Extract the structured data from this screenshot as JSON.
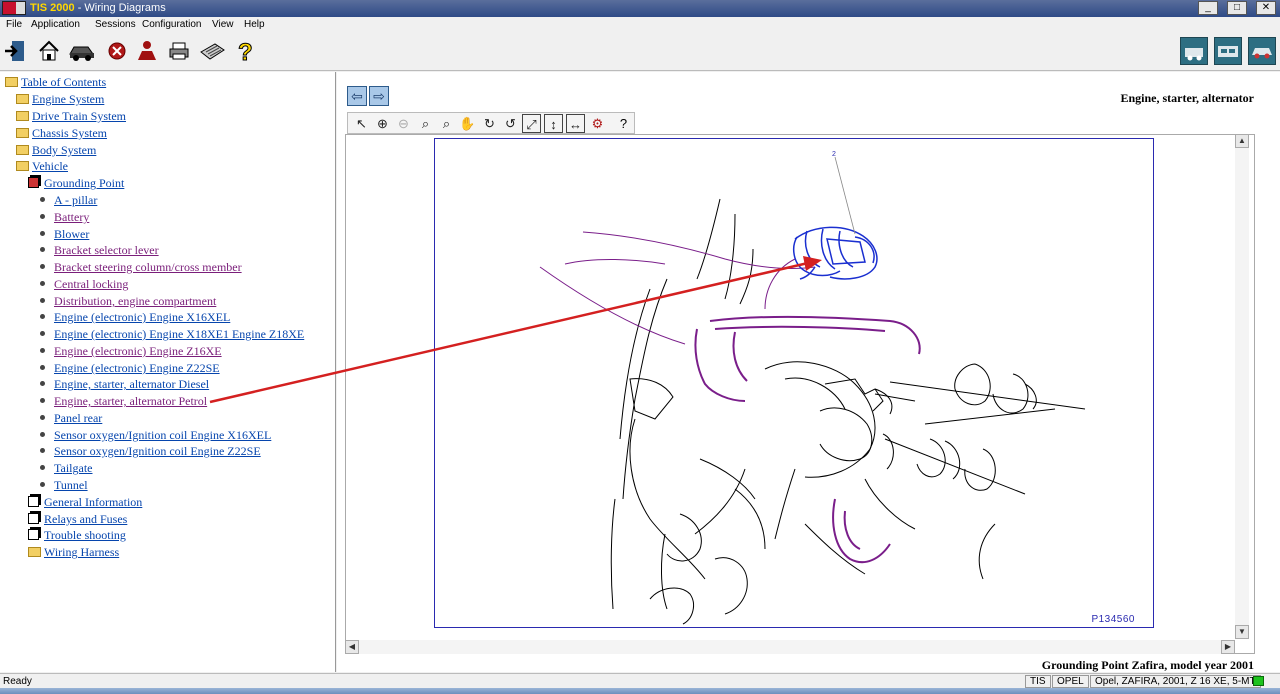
{
  "window": {
    "app_name": "TIS 2000",
    "title": " - Wiring Diagrams",
    "controls": [
      "_",
      "□",
      "✕"
    ]
  },
  "menu": [
    "File",
    "Application",
    "Sessions",
    "Configuration",
    "View",
    "Help"
  ],
  "toolbar_icons": [
    "exit-icon",
    "home-icon",
    "vehicle-icon",
    "stop-icon",
    "person-icon",
    "print-icon",
    "keyboard-icon",
    "help-icon"
  ],
  "toolbar_right_icons": [
    "vehicle-diagnostic-icon",
    "car-module-icon",
    "car-settings-icon"
  ],
  "tree": {
    "root": "Table of Contents",
    "items": [
      {
        "label": "Engine System"
      },
      {
        "label": "Drive Train System"
      },
      {
        "label": "Chassis System"
      },
      {
        "label": "Body System"
      },
      {
        "label": "Vehicle"
      },
      {
        "label": "Grounding Point"
      },
      {
        "label": "A - pillar"
      },
      {
        "label": "Battery"
      },
      {
        "label": "Blower"
      },
      {
        "label": "Bracket selector lever"
      },
      {
        "label": "Bracket steering column/cross member"
      },
      {
        "label": "Central locking"
      },
      {
        "label": "Distribution, engine compartment"
      },
      {
        "label": "Engine (electronic) Engine X16XEL"
      },
      {
        "label": "Engine (electronic) Engine X18XE1 Engine Z18XE"
      },
      {
        "label": "Engine (electronic) Engine Z16XE"
      },
      {
        "label": "Engine (electronic) Engine Z22SE"
      },
      {
        "label": "Engine, starter, alternator Diesel"
      },
      {
        "label": "Engine, starter, alternator Petrol"
      },
      {
        "label": "Panel rear"
      },
      {
        "label": "Sensor oxygen/Ignition coil Engine X16XEL"
      },
      {
        "label": "Sensor oxygen/Ignition coil Engine Z22SE"
      },
      {
        "label": "Tailgate"
      },
      {
        "label": "Tunnel"
      },
      {
        "label": "General Information"
      },
      {
        "label": "Relays and Fuses"
      },
      {
        "label": "Trouble shooting"
      },
      {
        "label": "Wiring Harness"
      }
    ]
  },
  "viewer": {
    "nav_back": "⇦",
    "nav_forward": "⇨",
    "section_title": "Engine, starter, alternator",
    "tools": [
      "select-tool-icon",
      "zoom-in-icon",
      "zoom-out-icon",
      "zoom-icon",
      "zoom-area-icon",
      "pan-icon",
      "rotate-cw-icon",
      "rotate-ccw-icon",
      "fit-all-icon",
      "fit-height-icon",
      "fit-width-icon",
      "color-icon",
      "help-icon"
    ],
    "callout": "2",
    "figure_number": "P134560",
    "caption": "Grounding Point Zafira, model year 2001"
  },
  "status": {
    "ready": "Ready",
    "system": "TIS",
    "brand": "OPEL",
    "vehicle": "Opel, ZAFIRA, 2001, Z 16 XE, 5-MT"
  },
  "colors": {
    "link": "#0645ad",
    "visited": "#7a1e7a",
    "diagram_blue": "#1a2fd0",
    "diagram_purple": "#7a1e8a",
    "arrow_red": "#d42020"
  }
}
